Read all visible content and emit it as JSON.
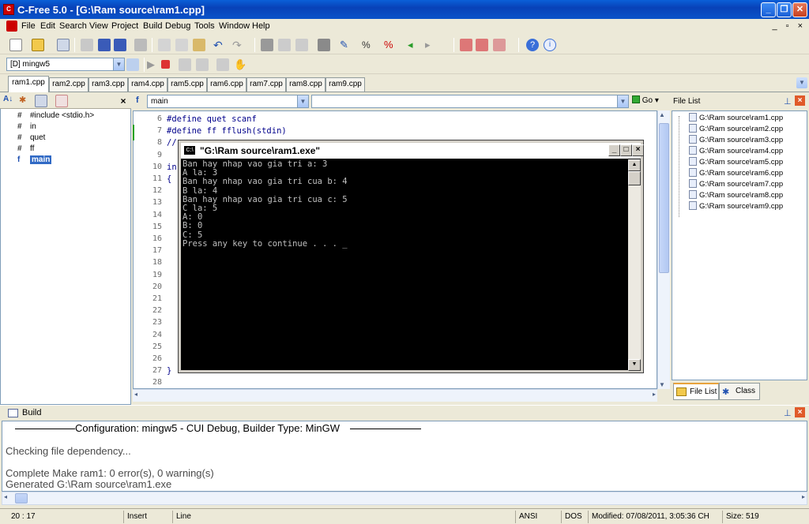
{
  "window": {
    "title": "C-Free 5.0 - [G:\\Ram source\\ram1.cpp]"
  },
  "menu": [
    "File",
    "Edit",
    "Search",
    "View",
    "Project",
    "Build",
    "Debug",
    "Tools",
    "Window",
    "Help"
  ],
  "mdi_controls": "_ ▫ ×",
  "compiler_combo": "[D] mingw5",
  "tabs": [
    "ram1.cpp",
    "ram2.cpp",
    "ram3.cpp",
    "ram4.cpp",
    "ram5.cpp",
    "ram6.cpp",
    "ram7.cpp",
    "ram8.cpp",
    "ram9.cpp"
  ],
  "symbols": [
    {
      "label": "#include <stdio.h>",
      "icon": "hash-icon"
    },
    {
      "label": "in",
      "icon": "hash-icon"
    },
    {
      "label": "quet",
      "icon": "hash-icon"
    },
    {
      "label": "ff",
      "icon": "hash-icon"
    },
    {
      "label": "main",
      "icon": "function-icon"
    }
  ],
  "editor": {
    "function_combo": "main",
    "go_label": "Go",
    "lines": [
      {
        "n": "6",
        "code": "#define quet scanf"
      },
      {
        "n": "7",
        "code": "#define ff fflush(stdin)"
      },
      {
        "n": "8",
        "code": "//"
      },
      {
        "n": "9",
        "code": ""
      },
      {
        "n": "10",
        "code": "in"
      },
      {
        "n": "11",
        "code": "{"
      },
      {
        "n": "12",
        "code": ""
      },
      {
        "n": "13",
        "code": ""
      },
      {
        "n": "14",
        "code": ""
      },
      {
        "n": "15",
        "code": ""
      },
      {
        "n": "16",
        "code": ""
      },
      {
        "n": "17",
        "code": ""
      },
      {
        "n": "18",
        "code": ""
      },
      {
        "n": "19",
        "code": ""
      },
      {
        "n": "20",
        "code": ""
      },
      {
        "n": "21",
        "code": ""
      },
      {
        "n": "22",
        "code": ""
      },
      {
        "n": "23",
        "code": ""
      },
      {
        "n": "24",
        "code": ""
      },
      {
        "n": "25",
        "code": ""
      },
      {
        "n": "26",
        "code": ""
      },
      {
        "n": "27",
        "code": "}"
      },
      {
        "n": "28",
        "code": ""
      }
    ]
  },
  "console": {
    "title": "\"G:\\Ram source\\ram1.exe\"",
    "lines": [
      "Ban hay nhap vao gia tri a: 3",
      "A la: 3",
      "Ban hay nhap vao gia tri cua b: 4",
      "B la: 4",
      "Ban hay nhap vao gia tri cua c: 5",
      "C la: 5",
      "A: 0",
      "B: 0",
      "C: 5",
      "Press any key to continue . . . _"
    ]
  },
  "file_list": {
    "header": "File List",
    "files": [
      "G:\\Ram source\\ram1.cpp",
      "G:\\Ram source\\ram2.cpp",
      "G:\\Ram source\\ram3.cpp",
      "G:\\Ram source\\ram4.cpp",
      "G:\\Ram source\\ram5.cpp",
      "G:\\Ram source\\ram6.cpp",
      "G:\\Ram source\\ram7.cpp",
      "G:\\Ram source\\ram8.cpp",
      "G:\\Ram source\\ram9.cpp"
    ],
    "tab_filelist": "File List",
    "tab_class": "Class"
  },
  "build": {
    "header": "Build",
    "config_line": "Configuration: mingw5 - CUI Debug, Builder Type: MinGW",
    "line1": "Checking file dependency...",
    "line2": "Complete Make ram1: 0 error(s), 0 warning(s)",
    "line3": "Generated G:\\Ram source\\ram1.exe"
  },
  "status": {
    "pos": "20 : 17",
    "mode": "Insert",
    "unit": "Line",
    "encoding": "ANSI",
    "lineend": "DOS",
    "modified": "Modified: 07/08/2011, 3:05:36 CH",
    "size": "Size: 519"
  },
  "colors": {
    "titlebar": "#0a53c9",
    "accent": "#316ac5",
    "console_bg": "#000000"
  }
}
